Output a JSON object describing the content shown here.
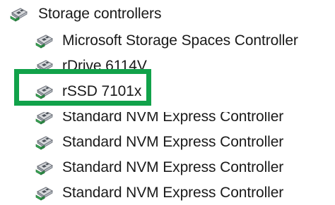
{
  "tree": {
    "category": {
      "label": "Storage controllers",
      "icon": "storage-controller-icon"
    },
    "devices": [
      {
        "label": "Microsoft Storage Spaces Controller",
        "icon": "storage-controller-icon"
      },
      {
        "label": "rDrive 6114V",
        "icon": "storage-controller-icon"
      },
      {
        "label": "rSSD 7101x",
        "icon": "storage-controller-icon"
      },
      {
        "label": "Standard NVM Express Controller",
        "icon": "storage-controller-icon"
      },
      {
        "label": "Standard NVM Express Controller",
        "icon": "storage-controller-icon"
      },
      {
        "label": "Standard NVM Express Controller",
        "icon": "storage-controller-icon"
      },
      {
        "label": "Standard NVM Express Controller",
        "icon": "storage-controller-icon"
      }
    ]
  },
  "highlight": {
    "color": "#11a24a",
    "target": "rSSD 7101x"
  }
}
